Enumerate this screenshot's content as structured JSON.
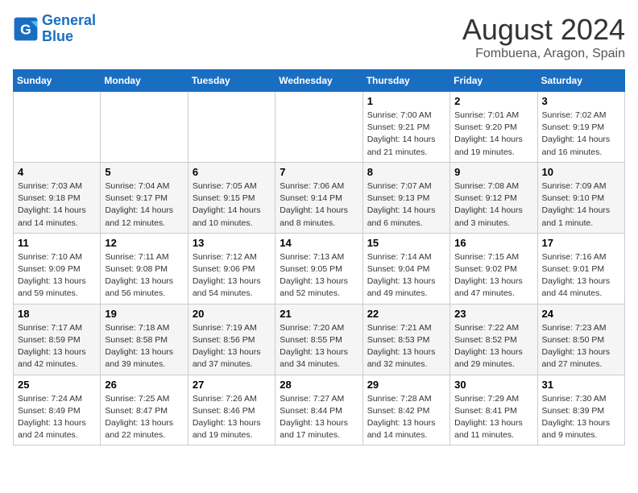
{
  "header": {
    "logo_line1": "General",
    "logo_line2": "Blue",
    "title": "August 2024",
    "subtitle": "Fombuena, Aragon, Spain"
  },
  "days_of_week": [
    "Sunday",
    "Monday",
    "Tuesday",
    "Wednesday",
    "Thursday",
    "Friday",
    "Saturday"
  ],
  "weeks": [
    {
      "days": [
        {
          "num": "",
          "info": ""
        },
        {
          "num": "",
          "info": ""
        },
        {
          "num": "",
          "info": ""
        },
        {
          "num": "",
          "info": ""
        },
        {
          "num": "1",
          "info": "Sunrise: 7:00 AM\nSunset: 9:21 PM\nDaylight: 14 hours\nand 21 minutes."
        },
        {
          "num": "2",
          "info": "Sunrise: 7:01 AM\nSunset: 9:20 PM\nDaylight: 14 hours\nand 19 minutes."
        },
        {
          "num": "3",
          "info": "Sunrise: 7:02 AM\nSunset: 9:19 PM\nDaylight: 14 hours\nand 16 minutes."
        }
      ]
    },
    {
      "days": [
        {
          "num": "4",
          "info": "Sunrise: 7:03 AM\nSunset: 9:18 PM\nDaylight: 14 hours\nand 14 minutes."
        },
        {
          "num": "5",
          "info": "Sunrise: 7:04 AM\nSunset: 9:17 PM\nDaylight: 14 hours\nand 12 minutes."
        },
        {
          "num": "6",
          "info": "Sunrise: 7:05 AM\nSunset: 9:15 PM\nDaylight: 14 hours\nand 10 minutes."
        },
        {
          "num": "7",
          "info": "Sunrise: 7:06 AM\nSunset: 9:14 PM\nDaylight: 14 hours\nand 8 minutes."
        },
        {
          "num": "8",
          "info": "Sunrise: 7:07 AM\nSunset: 9:13 PM\nDaylight: 14 hours\nand 6 minutes."
        },
        {
          "num": "9",
          "info": "Sunrise: 7:08 AM\nSunset: 9:12 PM\nDaylight: 14 hours\nand 3 minutes."
        },
        {
          "num": "10",
          "info": "Sunrise: 7:09 AM\nSunset: 9:10 PM\nDaylight: 14 hours\nand 1 minute."
        }
      ]
    },
    {
      "days": [
        {
          "num": "11",
          "info": "Sunrise: 7:10 AM\nSunset: 9:09 PM\nDaylight: 13 hours\nand 59 minutes."
        },
        {
          "num": "12",
          "info": "Sunrise: 7:11 AM\nSunset: 9:08 PM\nDaylight: 13 hours\nand 56 minutes."
        },
        {
          "num": "13",
          "info": "Sunrise: 7:12 AM\nSunset: 9:06 PM\nDaylight: 13 hours\nand 54 minutes."
        },
        {
          "num": "14",
          "info": "Sunrise: 7:13 AM\nSunset: 9:05 PM\nDaylight: 13 hours\nand 52 minutes."
        },
        {
          "num": "15",
          "info": "Sunrise: 7:14 AM\nSunset: 9:04 PM\nDaylight: 13 hours\nand 49 minutes."
        },
        {
          "num": "16",
          "info": "Sunrise: 7:15 AM\nSunset: 9:02 PM\nDaylight: 13 hours\nand 47 minutes."
        },
        {
          "num": "17",
          "info": "Sunrise: 7:16 AM\nSunset: 9:01 PM\nDaylight: 13 hours\nand 44 minutes."
        }
      ]
    },
    {
      "days": [
        {
          "num": "18",
          "info": "Sunrise: 7:17 AM\nSunset: 8:59 PM\nDaylight: 13 hours\nand 42 minutes."
        },
        {
          "num": "19",
          "info": "Sunrise: 7:18 AM\nSunset: 8:58 PM\nDaylight: 13 hours\nand 39 minutes."
        },
        {
          "num": "20",
          "info": "Sunrise: 7:19 AM\nSunset: 8:56 PM\nDaylight: 13 hours\nand 37 minutes."
        },
        {
          "num": "21",
          "info": "Sunrise: 7:20 AM\nSunset: 8:55 PM\nDaylight: 13 hours\nand 34 minutes."
        },
        {
          "num": "22",
          "info": "Sunrise: 7:21 AM\nSunset: 8:53 PM\nDaylight: 13 hours\nand 32 minutes."
        },
        {
          "num": "23",
          "info": "Sunrise: 7:22 AM\nSunset: 8:52 PM\nDaylight: 13 hours\nand 29 minutes."
        },
        {
          "num": "24",
          "info": "Sunrise: 7:23 AM\nSunset: 8:50 PM\nDaylight: 13 hours\nand 27 minutes."
        }
      ]
    },
    {
      "days": [
        {
          "num": "25",
          "info": "Sunrise: 7:24 AM\nSunset: 8:49 PM\nDaylight: 13 hours\nand 24 minutes."
        },
        {
          "num": "26",
          "info": "Sunrise: 7:25 AM\nSunset: 8:47 PM\nDaylight: 13 hours\nand 22 minutes."
        },
        {
          "num": "27",
          "info": "Sunrise: 7:26 AM\nSunset: 8:46 PM\nDaylight: 13 hours\nand 19 minutes."
        },
        {
          "num": "28",
          "info": "Sunrise: 7:27 AM\nSunset: 8:44 PM\nDaylight: 13 hours\nand 17 minutes."
        },
        {
          "num": "29",
          "info": "Sunrise: 7:28 AM\nSunset: 8:42 PM\nDaylight: 13 hours\nand 14 minutes."
        },
        {
          "num": "30",
          "info": "Sunrise: 7:29 AM\nSunset: 8:41 PM\nDaylight: 13 hours\nand 11 minutes."
        },
        {
          "num": "31",
          "info": "Sunrise: 7:30 AM\nSunset: 8:39 PM\nDaylight: 13 hours\nand 9 minutes."
        }
      ]
    }
  ]
}
